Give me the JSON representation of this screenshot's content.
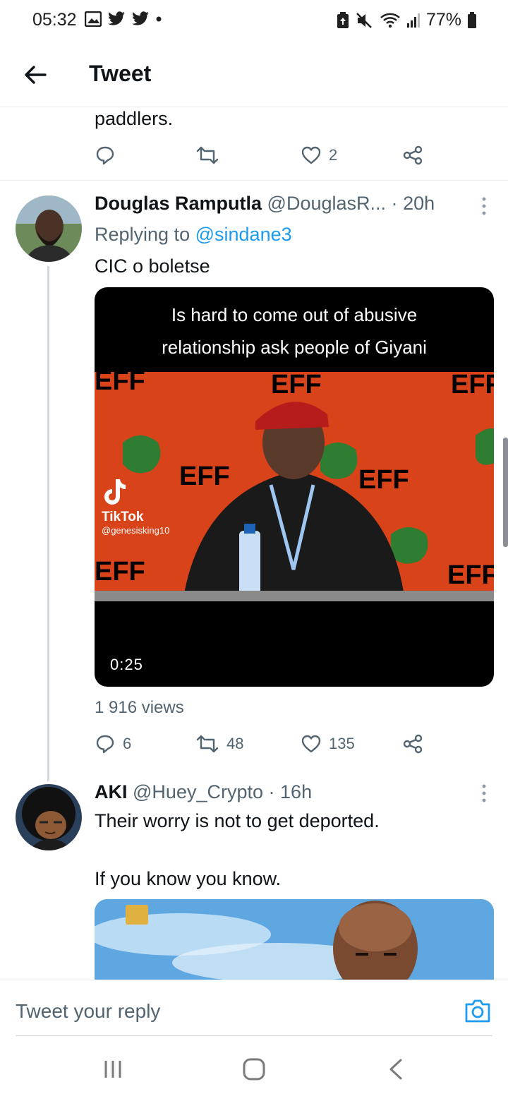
{
  "status_bar": {
    "time": "05:32",
    "battery": "77%",
    "icons_left": [
      "gallery-icon",
      "twitter-icon",
      "twitter-icon",
      "dot-icon"
    ],
    "icons_right": [
      "battery-saver-icon",
      "mute-icon",
      "wifi-icon",
      "signal-icon",
      "battery-icon"
    ]
  },
  "header": {
    "title": "Tweet"
  },
  "prev_tweet": {
    "text_tail": "paddlers.",
    "replies": "",
    "retweets": "",
    "likes": "2"
  },
  "tweet1": {
    "display_name": "Douglas Ramputla",
    "handle": "@DouglasR...",
    "separator": "·",
    "time": "20h",
    "replying_prefix": "Replying to",
    "replying_to": "@sindane3",
    "text": "CIC o boletse",
    "video": {
      "caption_line1": "Is hard to come out of abusive",
      "caption_line2": "relationship ask people of Giyani",
      "tiktok_label": "TikTok",
      "tiktok_user": "@genesisking10",
      "banner_text": "EFF",
      "duration": "0:25"
    },
    "views": "1 916 views",
    "replies": "6",
    "retweets": "48",
    "likes": "135"
  },
  "tweet2": {
    "display_name": "AKI",
    "handle": "@Huey_Crypto",
    "separator": "·",
    "time": "16h",
    "text_line1": "Their worry is not to get deported.",
    "text_line2": "If you know you know."
  },
  "reply_bar": {
    "placeholder": "Tweet your reply"
  },
  "colors": {
    "accent": "#1d9bf0",
    "text": "#0f1419",
    "secondary": "#536471",
    "divider": "#e6ecf0"
  }
}
